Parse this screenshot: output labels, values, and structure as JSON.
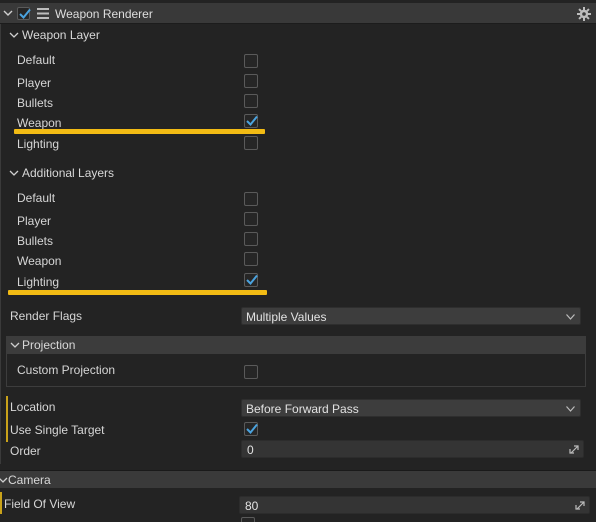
{
  "component": {
    "title": "Weapon Renderer",
    "enabled": true,
    "icons": {
      "collapse": "chevron-down-icon",
      "menu": "hamburger-menu-icon",
      "settings": "gear-icon"
    }
  },
  "weapon_layer": {
    "title": "Weapon Layer",
    "items": [
      {
        "label": "Default",
        "checked": false
      },
      {
        "label": "Player",
        "checked": false
      },
      {
        "label": "Bullets",
        "checked": false
      },
      {
        "label": "Weapon",
        "checked": true
      },
      {
        "label": "Lighting",
        "checked": false
      }
    ]
  },
  "additional_layers": {
    "title": "Additional Layers",
    "items": [
      {
        "label": "Default",
        "checked": false
      },
      {
        "label": "Player",
        "checked": false
      },
      {
        "label": "Bullets",
        "checked": false
      },
      {
        "label": "Weapon",
        "checked": false
      },
      {
        "label": "Lighting",
        "checked": true
      }
    ]
  },
  "render_flags": {
    "label": "Render Flags",
    "value": "Multiple Values"
  },
  "projection": {
    "title": "Projection",
    "custom_projection": {
      "label": "Custom Projection",
      "checked": false
    }
  },
  "location": {
    "label": "Location",
    "value": "Before Forward Pass"
  },
  "use_single_target": {
    "label": "Use Single Target",
    "checked": true
  },
  "order": {
    "label": "Order",
    "value": "0"
  },
  "camera": {
    "title": "Camera",
    "field_of_view": {
      "label": "Field Of View",
      "value": "80"
    }
  },
  "colors": {
    "highlight": "#f2bb14",
    "check_accent": "#4aa3df",
    "background": "#232323",
    "header": "#393939"
  }
}
